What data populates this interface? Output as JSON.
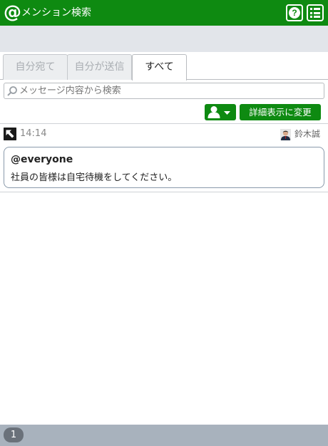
{
  "header": {
    "logo_glyph": "@",
    "title": "メンション検索",
    "help_glyph": "?",
    "color": "#0e8a11"
  },
  "tabs": [
    {
      "label": "自分宛て",
      "active": false
    },
    {
      "label": "自分が送信",
      "active": false
    },
    {
      "label": "すべて",
      "active": true
    }
  ],
  "search": {
    "placeholder": "メッセージ内容から検索",
    "value": "",
    "icon": "search-icon"
  },
  "toolbar": {
    "user_filter_icon": "user-dropdown-icon",
    "detail_button_label": "詳細表示に変更"
  },
  "message": {
    "jump_icon": "jump-arrow-icon",
    "time": "14:14",
    "sender": "鈴木誠",
    "mention": "@everyone",
    "body": "社員の皆様は自宅待機をしてください。"
  },
  "pagination": {
    "current_page": "1"
  }
}
